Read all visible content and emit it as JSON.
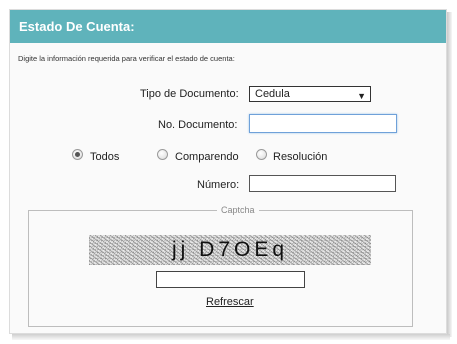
{
  "header": {
    "title": "Estado De Cuenta:"
  },
  "instructions": "Digite la información requerida para verificar el estado de cuenta:",
  "form": {
    "tipo_documento": {
      "label": "Tipo de Documento:",
      "selected": "Cedula"
    },
    "no_documento": {
      "label": "No. Documento:",
      "value": ""
    },
    "search_type": {
      "options": [
        {
          "label": "Todos",
          "checked": true
        },
        {
          "label": "Comparendo",
          "checked": false
        },
        {
          "label": "Resolución",
          "checked": false
        }
      ]
    },
    "numero": {
      "label": "Número:",
      "value": ""
    }
  },
  "captcha": {
    "legend": "Captcha",
    "image_text": "jj D7OEq",
    "input_value": "",
    "refresh_label": "Refrescar"
  },
  "icons": {
    "dropdown_arrow": "triangle-down"
  },
  "colors": {
    "header_bg": "#5fb3bb",
    "header_text": "#ffffff",
    "focus_border": "#6fa1d9"
  }
}
